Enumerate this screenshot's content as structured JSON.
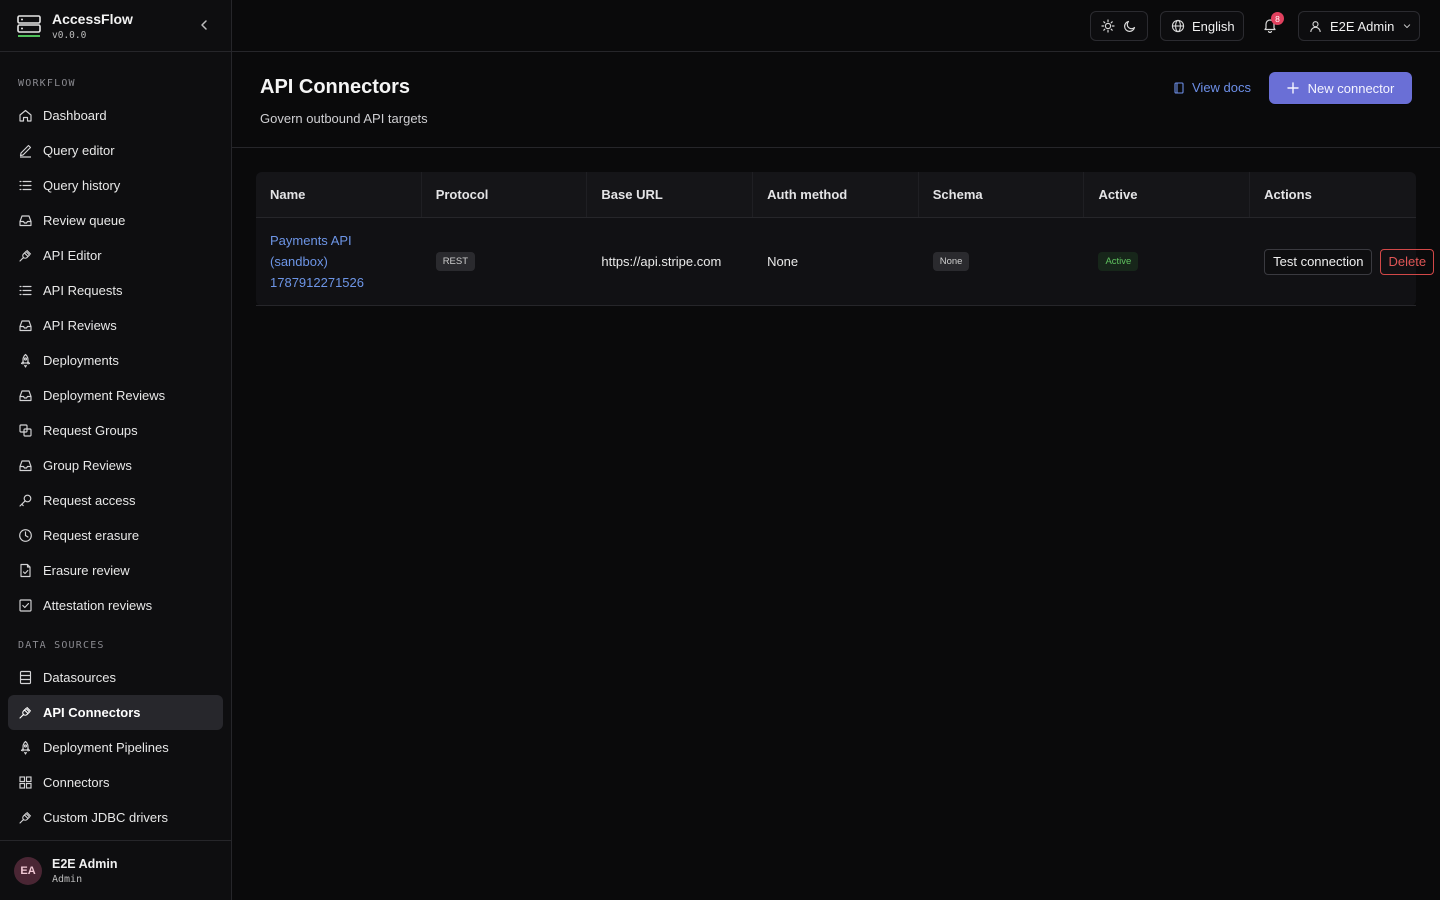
{
  "app": {
    "name": "AccessFlow",
    "version": "v0.0.0"
  },
  "sidebar": {
    "workflow_label": "WORKFLOW",
    "workflow_items": [
      {
        "label": "Dashboard",
        "icon": "home-icon"
      },
      {
        "label": "Query editor",
        "icon": "pencil-icon"
      },
      {
        "label": "Query history",
        "icon": "list-icon"
      },
      {
        "label": "Review queue",
        "icon": "inbox-icon"
      },
      {
        "label": "API Editor",
        "icon": "plug-icon"
      },
      {
        "label": "API Requests",
        "icon": "list-icon"
      },
      {
        "label": "API Reviews",
        "icon": "inbox-icon"
      },
      {
        "label": "Deployments",
        "icon": "rocket-icon"
      },
      {
        "label": "Deployment Reviews",
        "icon": "inbox-icon"
      },
      {
        "label": "Request Groups",
        "icon": "group-icon"
      },
      {
        "label": "Group Reviews",
        "icon": "inbox-icon"
      },
      {
        "label": "Request access",
        "icon": "key-icon"
      },
      {
        "label": "Request erasure",
        "icon": "clock-icon"
      },
      {
        "label": "Erasure review",
        "icon": "file-check-icon"
      },
      {
        "label": "Attestation reviews",
        "icon": "checkbox-icon"
      }
    ],
    "data_label": "DATA SOURCES",
    "data_items": [
      {
        "label": "Datasources",
        "icon": "database-icon",
        "active": false
      },
      {
        "label": "API Connectors",
        "icon": "plug-icon",
        "active": true
      },
      {
        "label": "Deployment Pipelines",
        "icon": "rocket-icon",
        "active": false
      },
      {
        "label": "Connectors",
        "icon": "grid-icon",
        "active": false
      },
      {
        "label": "Custom JDBC drivers",
        "icon": "plug-icon",
        "active": false
      }
    ],
    "user": {
      "initials": "EA",
      "name": "E2E Admin",
      "role": "Admin"
    }
  },
  "topbar": {
    "language": "English",
    "notifications_count": "8",
    "user_name": "E2E Admin"
  },
  "page": {
    "title": "API Connectors",
    "subtitle": "Govern outbound API targets",
    "view_docs": "View docs",
    "new_button": "New connector"
  },
  "table": {
    "columns": [
      "Name",
      "Protocol",
      "Base URL",
      "Auth method",
      "Schema",
      "Active",
      "Actions"
    ],
    "rows": [
      {
        "name_lines": [
          "Payments API",
          "(sandbox)",
          "1787912271526"
        ],
        "protocol": "REST",
        "base_url": "https://api.stripe.com",
        "auth_method": "None",
        "schema": "None",
        "active": "Active",
        "test_label": "Test connection",
        "delete_label": "Delete"
      }
    ]
  },
  "colors": {
    "accent": "#6a6fd6",
    "link": "#6d95e6",
    "danger": "#e05656",
    "success": "#5fc25f",
    "badge": "#e0405e"
  }
}
